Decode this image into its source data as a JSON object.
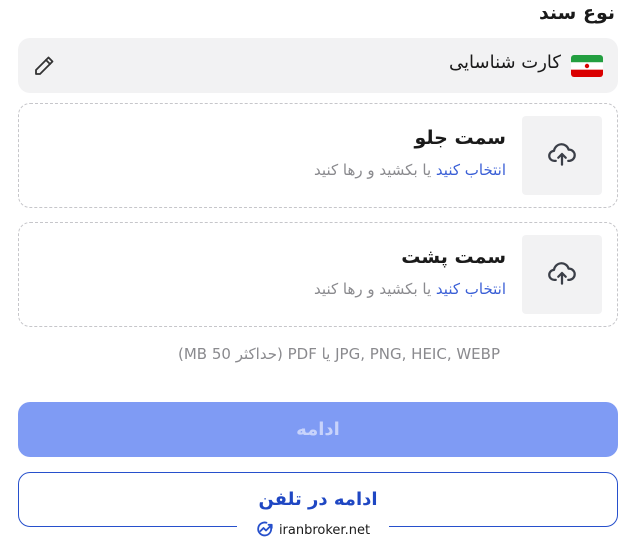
{
  "section_title": "نوع سند",
  "document": {
    "selected_label": "کارت شناسایی",
    "flag_icon": "iran-flag-icon",
    "edit_icon": "pencil-icon"
  },
  "upload_front": {
    "title": "سمت جلو",
    "choose_text": "انتخاب کنید",
    "drag_text": "یا بکشید و رها کنید",
    "icon": "cloud-upload-icon"
  },
  "upload_back": {
    "title": "سمت پشت",
    "choose_text": "انتخاب کنید",
    "drag_text": "یا بکشید و رها کنید",
    "icon": "cloud-upload-icon"
  },
  "formats_note": "JPG, PNG, HEIC, WEBP یا PDF (حداکثر 50 MB)",
  "continue_button": "ادامه",
  "phone_button": "ادامه در تلفن",
  "watermark": {
    "text": "iranbroker.net",
    "icon": "iranbroker-logo-icon"
  },
  "colors": {
    "primary": "#2750cc",
    "primary_disabled": "#7f9bf4",
    "link": "#3a5fd6",
    "muted_text": "#8a8a8e",
    "surface": "#f2f2f3"
  }
}
